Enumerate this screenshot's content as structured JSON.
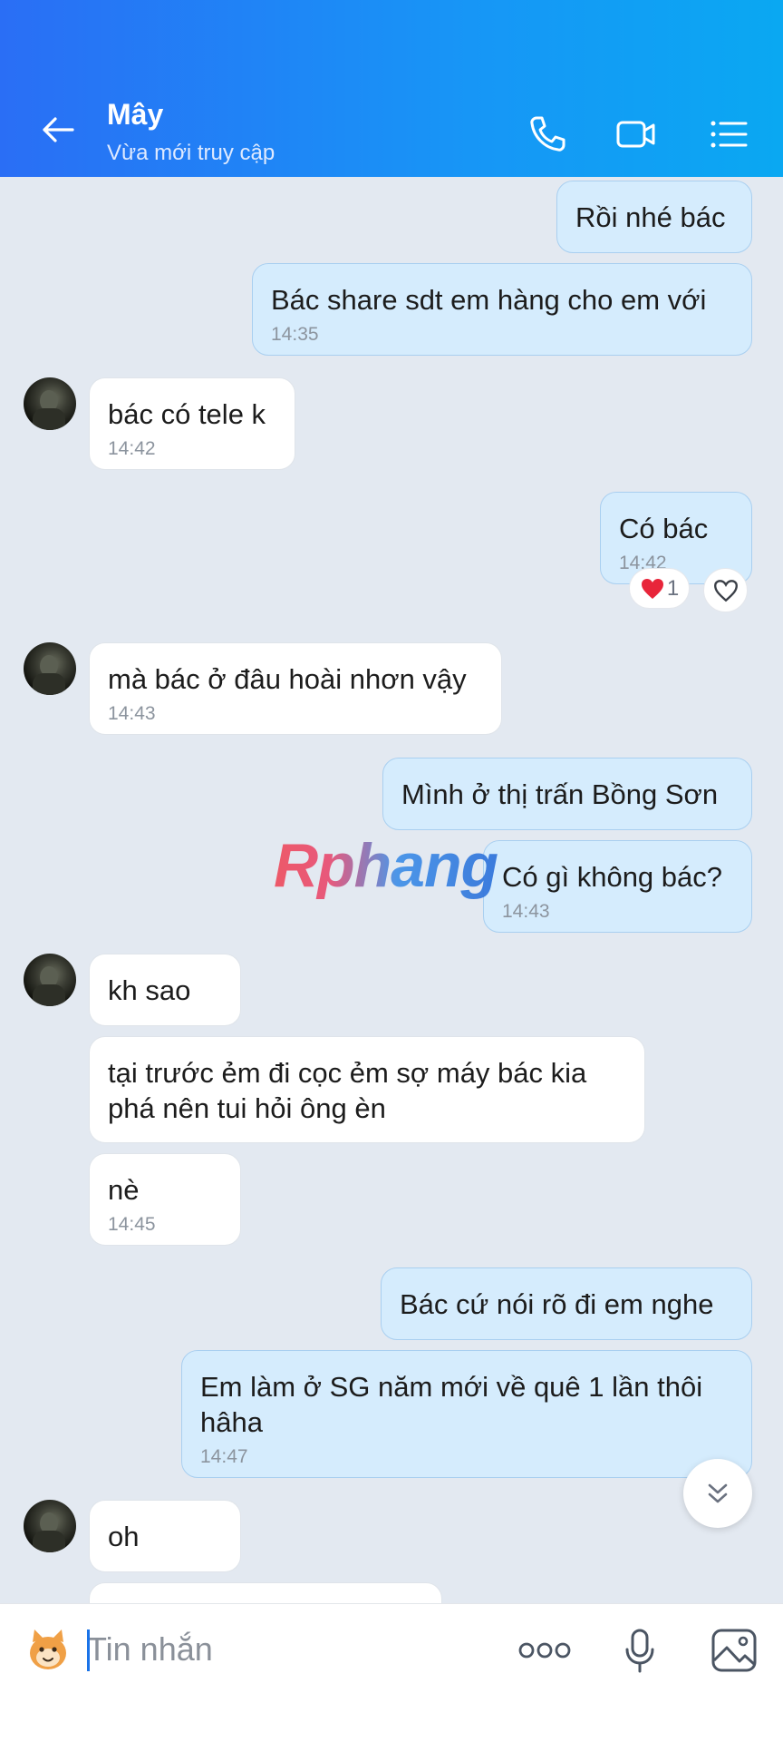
{
  "header": {
    "title": "Mây",
    "subtitle": "Vừa mới truy cập",
    "icons": [
      "back-arrow-icon",
      "phone-icon",
      "video-call-icon",
      "list-menu-icon"
    ]
  },
  "messages": [
    {
      "dir": "out",
      "text": "Rồi nhé bác",
      "time": ""
    },
    {
      "dir": "out",
      "text": "Bác share sdt em hàng cho em với",
      "time": "14:35"
    },
    {
      "dir": "in",
      "text": "bác có tele k",
      "time": "14:42"
    },
    {
      "dir": "out",
      "text": "Có bác",
      "time": "14:42"
    },
    {
      "dir": "in",
      "text": "mà bác ở đâu hoài nhơn vậy",
      "time": "14:43"
    },
    {
      "dir": "out",
      "text": "Mình ở thị trấn Bồng Sơn",
      "time": ""
    },
    {
      "dir": "out",
      "text": "Có gì không bác?",
      "time": "14:43"
    },
    {
      "dir": "in",
      "text": "kh sao",
      "time": ""
    },
    {
      "dir": "in",
      "text": "tại trước ẻm đi cọc ẻm sợ máy bác kia phá nên tui hỏi ông èn",
      "time": ""
    },
    {
      "dir": "in",
      "text": "nè",
      "time": "14:45"
    },
    {
      "dir": "out",
      "text": "Bác cứ nói rõ đi em nghe",
      "time": ""
    },
    {
      "dir": "out",
      "text": "Em làm ở SG năm mới về quê 1 lần thôi hâha",
      "time": "14:47"
    },
    {
      "dir": "in",
      "text": "oh",
      "time": ""
    }
  ],
  "reaction": {
    "count": "1",
    "emoji": "❤️"
  },
  "watermark": "Rphang",
  "composer": {
    "placeholder": "Tin nhắn"
  },
  "colors": {
    "header_start": "#2a6ef5",
    "header_end": "#0aa8f2",
    "outgoing_bubble": "#d5ecfd",
    "incoming_bubble": "#ffffff",
    "background": "#e3e9f1"
  }
}
